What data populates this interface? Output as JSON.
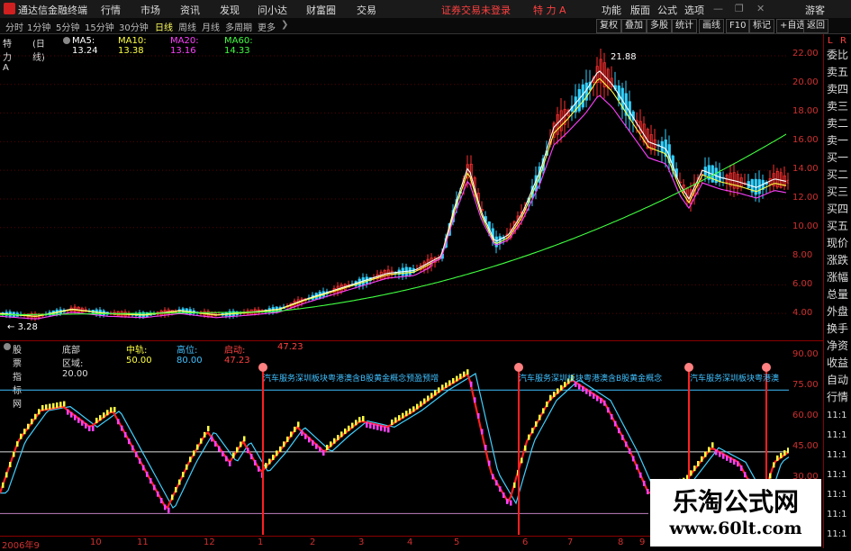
{
  "titlebar": {
    "app_title": "通达信金融终端",
    "menu": [
      "行情",
      "市场",
      "资讯",
      "发现",
      "问小达",
      "财富圈",
      "交易"
    ],
    "login_warning": "证券交易未登录",
    "stock": "特 力 A",
    "right_menu": [
      "功能",
      "版面",
      "公式",
      "选项"
    ],
    "guest": "游客"
  },
  "toolbar": {
    "timeframes": [
      "分时",
      "1分钟",
      "5分钟",
      "15分钟",
      "30分钟",
      "日线",
      "周线",
      "月线",
      "多周期",
      "更多"
    ],
    "active_timeframe": "日线",
    "right_buttons": [
      "复权",
      "叠加",
      "多股",
      "统计",
      "画线",
      "F10",
      "标记",
      "+自选",
      "返回"
    ]
  },
  "price_chart": {
    "stock_name": "特 力 A",
    "period": "(日线)",
    "ma": [
      {
        "label": "MA5: 13.24",
        "color": "#ffffff"
      },
      {
        "label": "MA10: 13.38",
        "color": "#ffff40"
      },
      {
        "label": "MA20: 13.16",
        "color": "#ff40ff"
      },
      {
        "label": "MA60: 14.33",
        "color": "#40ff40"
      }
    ],
    "high_label": "21.88",
    "low_label": "3.28",
    "y_ticks": [
      "22.00",
      "20.00",
      "18.00",
      "16.00",
      "14.00",
      "12.00",
      "10.00",
      "8.00",
      "6.00",
      "4.00"
    ]
  },
  "indicator": {
    "name": "股票指标网",
    "params": [
      {
        "label": "底部区域: 20.00",
        "color": "#dddddd"
      },
      {
        "label": "中轨: 50.00",
        "color": "#ffff40"
      },
      {
        "label": "高位: 80.00",
        "color": "#40c0ff"
      },
      {
        "label": "启动: 47.23",
        "color": "#ff4040"
      },
      {
        "label": "47.23",
        "color": "#ff4040"
      }
    ],
    "y_ticks": [
      "90.00",
      "75.00",
      "60.00",
      "45.00",
      "30.00"
    ],
    "annotation_1": "汽车服务深圳板块粤港澳含B股黄金概念预盈预增",
    "annotation_2": "汽车服务深圳板块粤港澳含B股黄金概念",
    "annotation_3": "汽车服务深圳板块粤港澳"
  },
  "right_panel": {
    "tag_l": "L",
    "tag_r": "R",
    "items": [
      "委比",
      "卖五",
      "卖四",
      "卖三",
      "卖二",
      "卖一",
      "买一",
      "买二",
      "买三",
      "买四",
      "买五",
      "现价",
      "涨跌",
      "涨幅",
      "总量",
      "外盘",
      "换手",
      "净资",
      "收益",
      "自动",
      "行情"
    ],
    "times": [
      "11:1",
      "11:1",
      "11:1",
      "11:1",
      "11:1",
      "11:1",
      "11:1"
    ]
  },
  "xaxis": {
    "labels": [
      "2006年9",
      "10",
      "11",
      "12",
      "1",
      "2",
      "3",
      "4",
      "5",
      "6",
      "7",
      "8",
      "9",
      "10"
    ]
  },
  "watermark": {
    "cn": "乐淘公式网",
    "url": "www.60lt.com"
  },
  "colors": {
    "up": "#ff3030",
    "down": "#30d0ff",
    "grid": "#5a0000"
  }
}
